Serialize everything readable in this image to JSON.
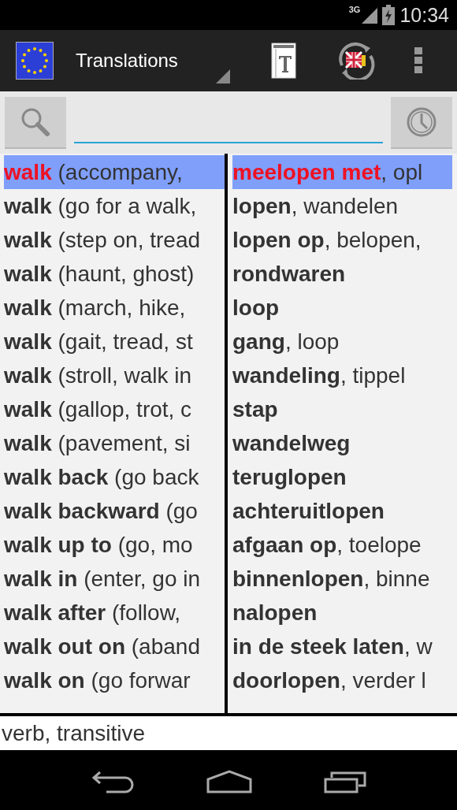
{
  "status_bar": {
    "network": "3G",
    "time": "10:34"
  },
  "action_bar": {
    "title": "Translations"
  },
  "rows": [
    {
      "source": "**walk** (accompany,",
      "target": "**meelopen met**, opl",
      "selected": true
    },
    {
      "source": "**walk** (go for a walk,",
      "target": "**lopen**, wandelen",
      "selected": false
    },
    {
      "source": "**walk** (step on, tread",
      "target": "**lopen op**, belopen,",
      "selected": false
    },
    {
      "source": "**walk** (haunt, ghost)",
      "target": "**rondwaren**",
      "selected": false
    },
    {
      "source": "**walk** (march, hike,",
      "target": "**loop**",
      "selected": false
    },
    {
      "source": "**walk** (gait, tread, st",
      "target": "**gang**, loop",
      "selected": false
    },
    {
      "source": "**walk** (stroll, walk in",
      "target": "**wandeling**, tippel",
      "selected": false
    },
    {
      "source": "**walk** (gallop, trot, c",
      "target": "**stap**",
      "selected": false
    },
    {
      "source": "**walk** (pavement, si",
      "target": "**wandelweg**",
      "selected": false
    },
    {
      "source": "**walk back** (go back",
      "target": "**teruglopen**",
      "selected": false
    },
    {
      "source": "**walk backward** (go",
      "target": "**achteruitlopen**",
      "selected": false
    },
    {
      "source": "**walk up to** (go, mo",
      "target": "**afgaan op**, toelope",
      "selected": false
    },
    {
      "source": "**walk in** (enter, go in",
      "target": "**binnenlopen**, binne",
      "selected": false
    },
    {
      "source": "**walk after** (follow,",
      "target": "**nalopen**",
      "selected": false
    },
    {
      "source": "**walk out on** (aband",
      "target": "**in de steek laten**, w",
      "selected": false
    },
    {
      "source": "**walk on** (go forwar",
      "target": "**doorlopen**, verder l",
      "selected": false
    }
  ],
  "footer": {
    "text": "verb, transitive"
  }
}
